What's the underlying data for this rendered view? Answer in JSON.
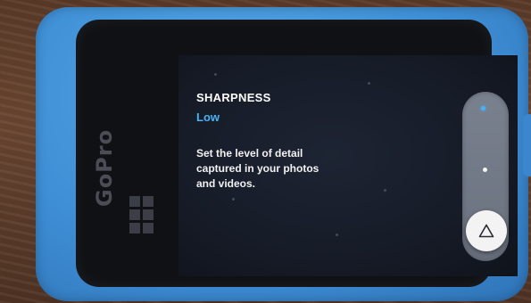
{
  "setting": {
    "title": "SHARPNESS",
    "value": "Low",
    "description": "Set the level of detail captured in your photos and videos."
  },
  "slider": {
    "selected_level": "Low",
    "handle_icon": "triangle-icon"
  },
  "device": {
    "brand_logo": "GoPro"
  },
  "colors": {
    "accent": "#49b2f5",
    "case": "#3f8fd6",
    "screen": "#161b27"
  }
}
